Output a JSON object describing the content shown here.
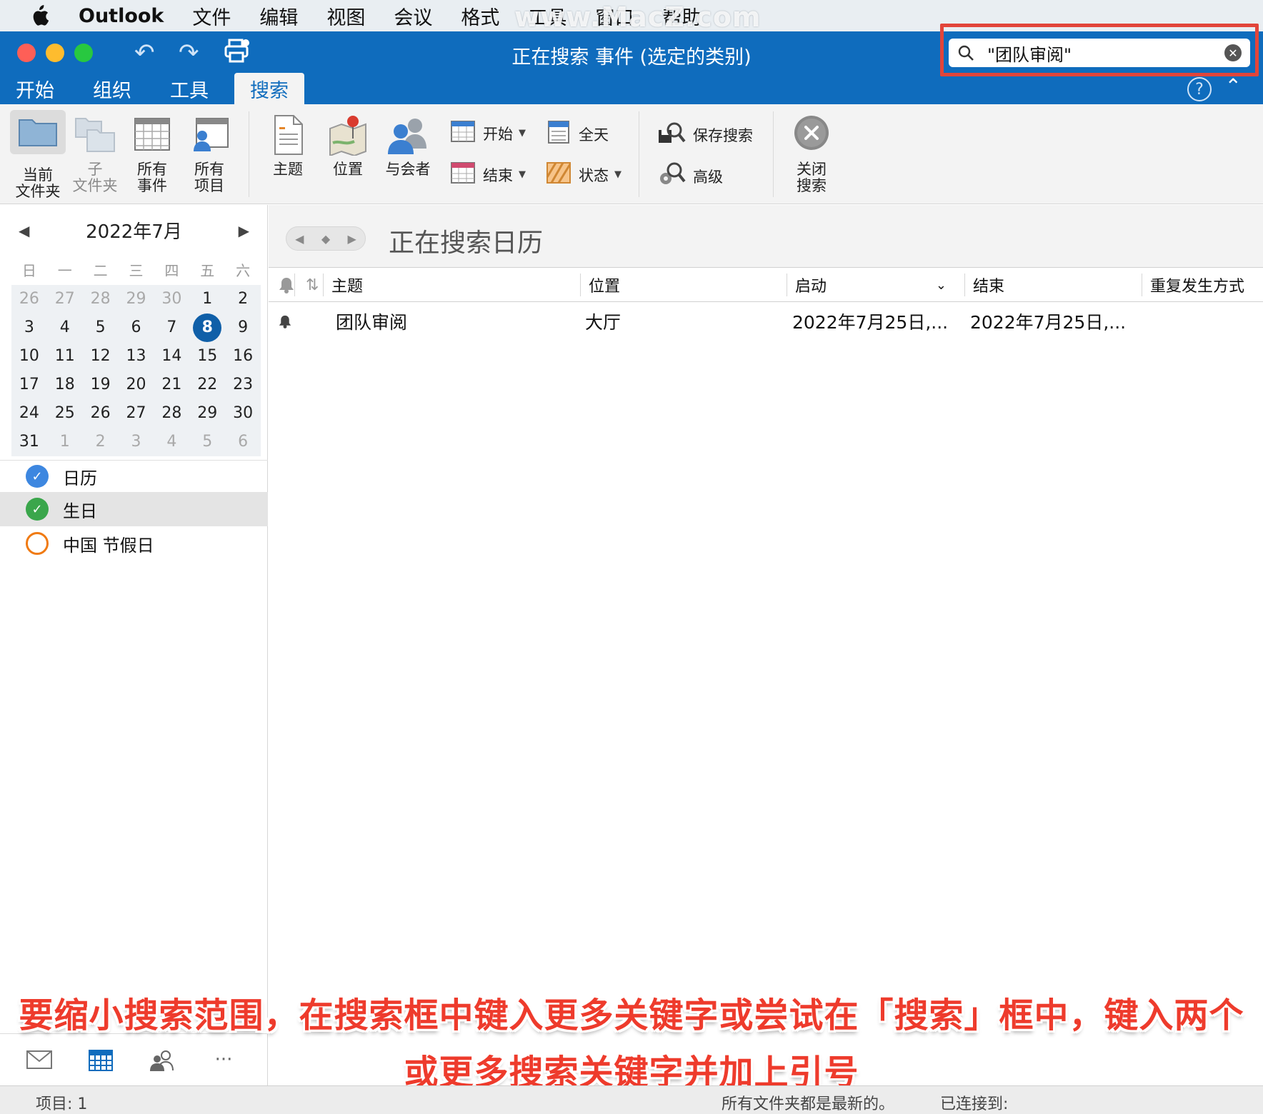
{
  "menubar": {
    "app": "Outlook",
    "items": [
      "文件",
      "编辑",
      "视图",
      "会议",
      "格式",
      "工具",
      "窗口",
      "帮助"
    ],
    "watermark": "www.MacZ.com"
  },
  "window": {
    "title": "正在搜索 事件 (选定的类别)",
    "search_value": "\"团队审阅\""
  },
  "tabs": [
    "开始",
    "组织",
    "工具",
    "搜索"
  ],
  "active_tab": "搜索",
  "ribbon": {
    "current_folder": [
      "当前",
      "文件夹"
    ],
    "subfolder": [
      "子",
      "文件夹"
    ],
    "all_events": [
      "所有",
      "事件"
    ],
    "all_items": [
      "所有",
      "项目"
    ],
    "subject": "主题",
    "location": "位置",
    "attendees": "与会者",
    "start": "开始",
    "end": "结束",
    "all_day": "全天",
    "status": "状态",
    "save_search": "保存搜索",
    "advanced": "高级",
    "close_search": [
      "关闭",
      "搜索"
    ]
  },
  "calendar": {
    "title": "2022年7月",
    "weekdays": [
      "日",
      "一",
      "二",
      "三",
      "四",
      "五",
      "六"
    ],
    "weeks": [
      [
        {
          "d": "26",
          "o": true
        },
        {
          "d": "27",
          "o": true
        },
        {
          "d": "28",
          "o": true
        },
        {
          "d": "29",
          "o": true
        },
        {
          "d": "30",
          "o": true
        },
        {
          "d": "1"
        },
        {
          "d": "2"
        }
      ],
      [
        {
          "d": "3"
        },
        {
          "d": "4"
        },
        {
          "d": "5"
        },
        {
          "d": "6"
        },
        {
          "d": "7"
        },
        {
          "d": "8",
          "t": true
        },
        {
          "d": "9"
        }
      ],
      [
        {
          "d": "10"
        },
        {
          "d": "11"
        },
        {
          "d": "12"
        },
        {
          "d": "13"
        },
        {
          "d": "14"
        },
        {
          "d": "15"
        },
        {
          "d": "16"
        }
      ],
      [
        {
          "d": "17"
        },
        {
          "d": "18"
        },
        {
          "d": "19"
        },
        {
          "d": "20"
        },
        {
          "d": "21"
        },
        {
          "d": "22"
        },
        {
          "d": "23"
        }
      ],
      [
        {
          "d": "24"
        },
        {
          "d": "25"
        },
        {
          "d": "26"
        },
        {
          "d": "27"
        },
        {
          "d": "28"
        },
        {
          "d": "29"
        },
        {
          "d": "30"
        }
      ],
      [
        {
          "d": "31"
        },
        {
          "d": "1",
          "o": true
        },
        {
          "d": "2",
          "o": true
        },
        {
          "d": "3",
          "o": true
        },
        {
          "d": "4",
          "o": true
        },
        {
          "d": "5",
          "o": true
        },
        {
          "d": "6",
          "o": true
        }
      ]
    ],
    "lists": [
      {
        "name": "日历",
        "color": "#3d87e0",
        "checked": true
      },
      {
        "name": "生日",
        "color": "#3aa64b",
        "checked": true
      },
      {
        "name": "中国 节假日",
        "color": "#f07a12",
        "checked": false
      }
    ]
  },
  "main": {
    "title": "正在搜索日历",
    "columns": {
      "subject": "主题",
      "location": "位置",
      "start": "启动",
      "end": "结束",
      "recurrence": "重复发生方式"
    },
    "rows": [
      {
        "subject": "团队审阅",
        "location": "大厅",
        "start": "2022年7月25日,...",
        "end": "2022年7月25日,..."
      }
    ]
  },
  "caption": {
    "line1": "要缩小搜索范围，在搜索框中键入更多关键字或尝试在「搜索」框中，键入两个",
    "line2": "或更多搜索关键字并加上引号"
  },
  "status": {
    "items": "项目: 1",
    "sync": "所有文件夹都是最新的。",
    "connected": "已连接到:"
  },
  "colors": {
    "brand_blue": "#0f6cbd",
    "highlight_red": "#e2453a",
    "today": "#0f5fa8"
  }
}
